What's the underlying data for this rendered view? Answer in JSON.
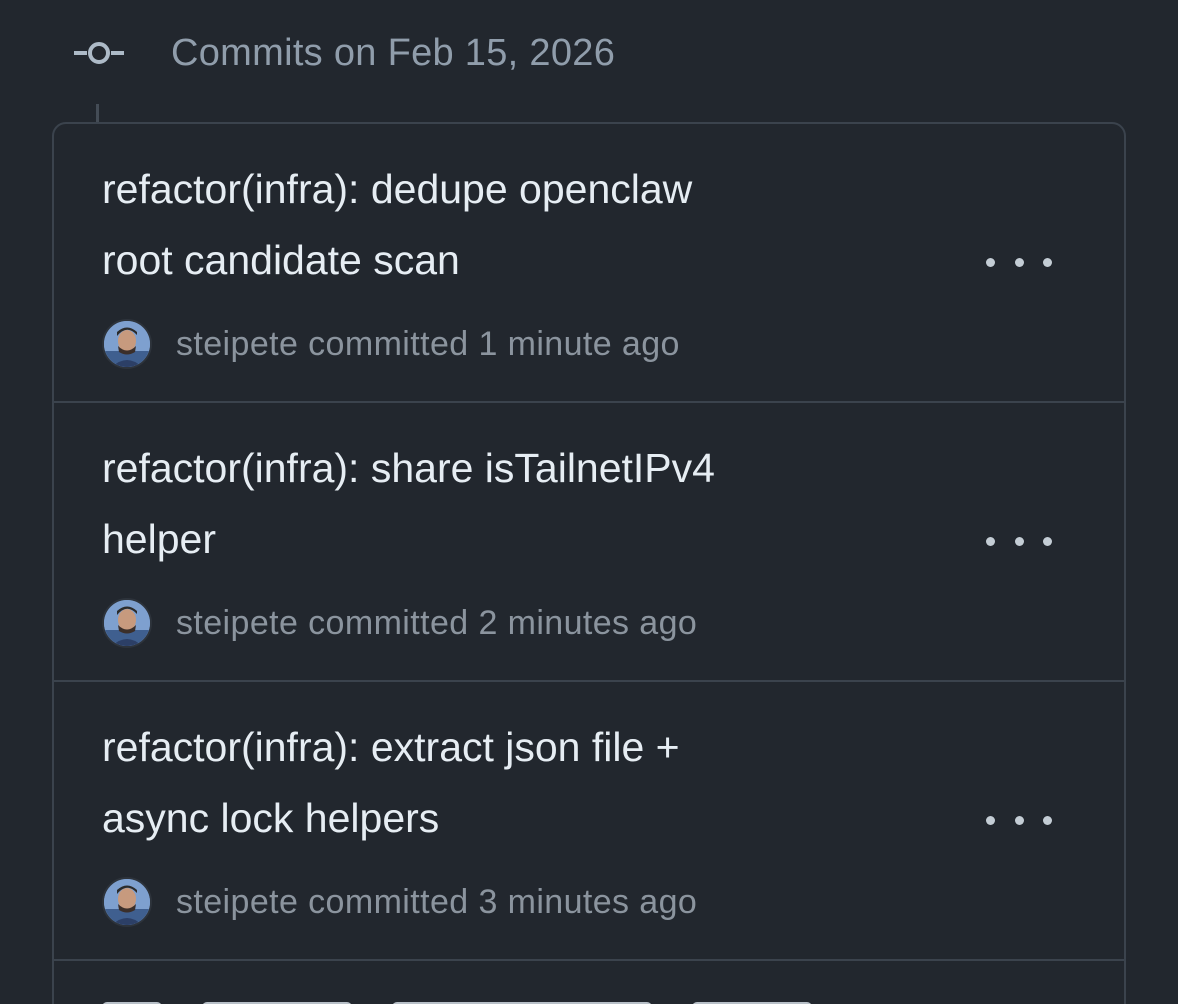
{
  "group": {
    "title": "Commits on Feb 15, 2026",
    "icon": "git-commit-icon"
  },
  "commits": [
    {
      "message_line1": "refactor(infra): dedupe openclaw",
      "message_line2": "root candidate scan",
      "author": "steipete",
      "action": "committed",
      "time": "1 minute ago"
    },
    {
      "message_line1": "refactor(infra): share isTailnetIPv4",
      "message_line2": "helper",
      "author": "steipete",
      "action": "committed",
      "time": "2 minutes ago"
    },
    {
      "message_line1": "refactor(infra): extract json file +",
      "message_line2": "async lock helpers",
      "author": "steipete",
      "action": "committed",
      "time": "3 minutes ago"
    }
  ],
  "colors": {
    "background": "#22272e",
    "border": "#3b434d",
    "text_primary": "#e6edf3",
    "text_muted": "#8b949e"
  }
}
